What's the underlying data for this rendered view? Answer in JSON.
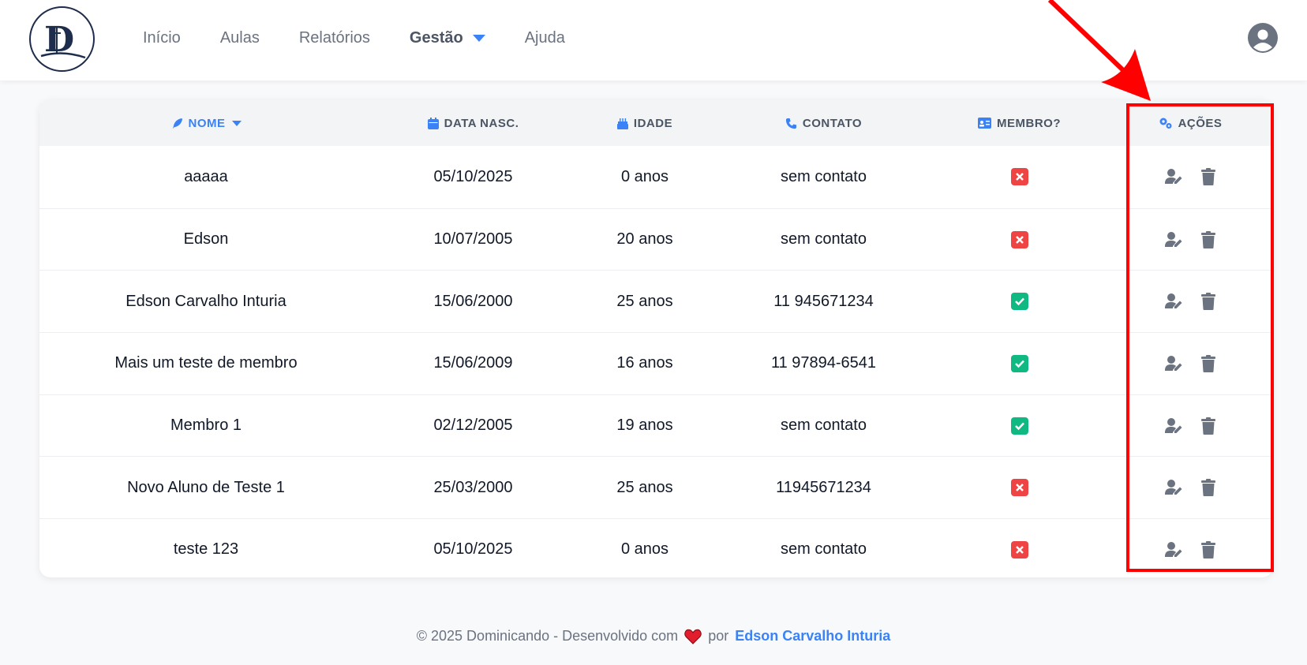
{
  "nav": {
    "items": [
      {
        "label": "Início"
      },
      {
        "label": "Aulas"
      },
      {
        "label": "Relatórios"
      },
      {
        "label": "Gestão",
        "active": true
      },
      {
        "label": "Ajuda"
      }
    ]
  },
  "table": {
    "columns": {
      "nome": "NOME",
      "data": "DATA NASC.",
      "idade": "IDADE",
      "contato": "CONTATO",
      "membro": "MEMBRO?",
      "acoes": "AÇÕES"
    },
    "rows": [
      {
        "nome": "aaaaa",
        "data": "05/10/2025",
        "idade": "0 anos",
        "contato": "sem contato",
        "membro": false
      },
      {
        "nome": "Edson",
        "data": "10/07/2005",
        "idade": "20 anos",
        "contato": "sem contato",
        "membro": false
      },
      {
        "nome": "Edson Carvalho Inturia",
        "data": "15/06/2000",
        "idade": "25 anos",
        "contato": "11 945671234",
        "membro": true
      },
      {
        "nome": "Mais um teste de membro",
        "data": "15/06/2009",
        "idade": "16 anos",
        "contato": "11 97894-6541",
        "membro": true
      },
      {
        "nome": "Membro 1",
        "data": "02/12/2005",
        "idade": "19 anos",
        "contato": "sem contato",
        "membro": true
      },
      {
        "nome": "Novo Aluno de Teste 1",
        "data": "25/03/2000",
        "idade": "25 anos",
        "contato": "11945671234",
        "membro": false
      },
      {
        "nome": "teste 123",
        "data": "05/10/2025",
        "idade": "0 anos",
        "contato": "sem contato",
        "membro": false
      }
    ]
  },
  "footer": {
    "copyright": "© 2025 Dominicando - Desenvolvido com",
    "por": "por",
    "author": "Edson Carvalho Inturia"
  },
  "colors": {
    "accent": "#3b82f6",
    "yes": "#10b981",
    "no": "#ef4444",
    "annotation": "#ff0000"
  },
  "icons": [
    "logo",
    "chevron-down-icon",
    "user-circle-icon",
    "feather-icon",
    "calendar-icon",
    "cake-icon",
    "phone-icon",
    "id-card-icon",
    "gears-icon",
    "user-edit-icon",
    "trash-icon",
    "check-icon",
    "x-icon",
    "heart-icon"
  ]
}
